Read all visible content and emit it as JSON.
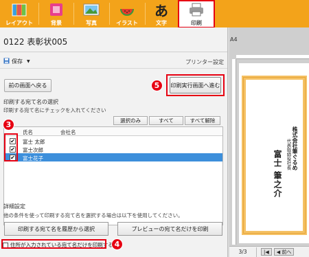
{
  "toolbar": {
    "items": [
      {
        "label": "レイアウト",
        "icon": "layout-icon"
      },
      {
        "label": "背景",
        "icon": "background-icon"
      },
      {
        "label": "写真",
        "icon": "photo-icon"
      },
      {
        "label": "イラスト",
        "icon": "illustration-icon"
      },
      {
        "label": "文字",
        "icon": "text-icon"
      },
      {
        "label": "印刷",
        "icon": "printer-icon"
      }
    ],
    "active": "印刷"
  },
  "document": {
    "title": "0122  表彰状005"
  },
  "save": {
    "label": "保存",
    "icon": "floppy-icon"
  },
  "printer_settings": "プリンター設定",
  "buttons": {
    "back": "前の画面へ戻る",
    "run": "印刷実行画面へ進む",
    "select_only": "選択のみ",
    "all": "すべて",
    "clear_all": "すべて解除",
    "from_history": "印刷する宛て名を履歴から選択",
    "preview_only": "プレビューの宛て名だけを印刷"
  },
  "recipient_section": {
    "heading": "印刷する宛て名の選択",
    "instruction": "印刷する宛て名にチェックを入れてください",
    "columns": [
      "氏名",
      "会社名"
    ],
    "rows": [
      {
        "name": "富士 太郎",
        "company": "",
        "checked": true,
        "selected": false
      },
      {
        "name": "富士次郎",
        "company": "",
        "checked": true,
        "selected": false
      },
      {
        "name": "富士花子",
        "company": "",
        "checked": true,
        "selected": true
      }
    ]
  },
  "detail_section": {
    "heading": "詳細設定",
    "instruction": "他の条件を使って印刷する宛て名を選択する場合は以下を使用してください。"
  },
  "address_only": {
    "label": "住所が入力されている宛て名だけを印刷する",
    "checked": false
  },
  "badges": {
    "three": "3",
    "four": "4",
    "five": "5"
  },
  "preview": {
    "paper_size": "A4",
    "text_company": "株式会社筆ぐるめ",
    "text_role": "代表取締役社長",
    "text_name": "富士 筆之介",
    "page": "3/3",
    "prev": "前へ"
  },
  "colors": {
    "toolbar": "#f3a31a",
    "highlight": "#e60012",
    "selection": "#3d8fdb"
  }
}
